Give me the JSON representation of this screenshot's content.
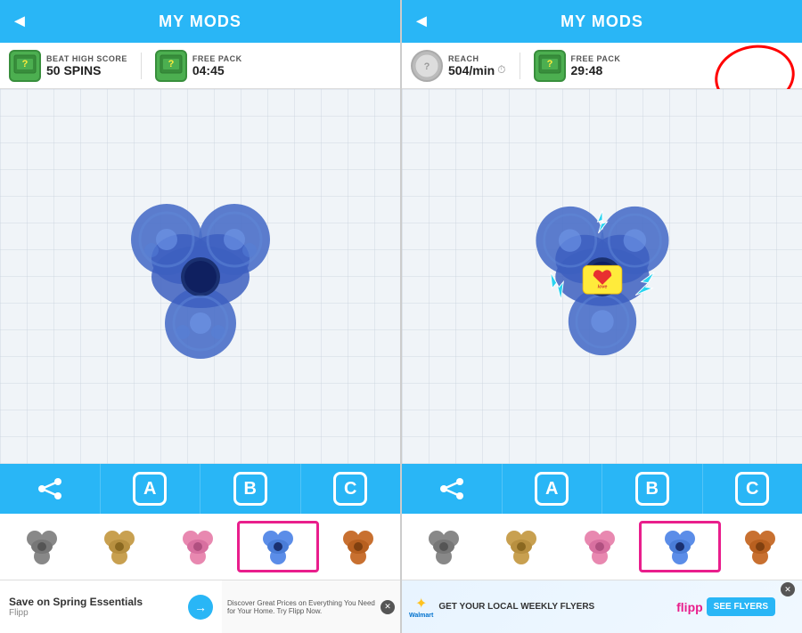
{
  "left_screen": {
    "header": {
      "title": "MY MODS",
      "back_label": "◄"
    },
    "stats": {
      "item1": {
        "label": "BEAT HIGH SCORE",
        "value": "50 SPINS"
      },
      "item2": {
        "label": "FREE PACK",
        "value": "04:45"
      }
    },
    "tabs": [
      {
        "id": "share",
        "label": "⁖",
        "type": "share"
      },
      {
        "id": "A",
        "label": "A"
      },
      {
        "id": "B",
        "label": "B"
      },
      {
        "id": "C",
        "label": "C"
      }
    ],
    "thumbnails": [
      {
        "id": "t1",
        "color": "#888",
        "selected": false
      },
      {
        "id": "t2",
        "color": "#c8a050",
        "selected": false
      },
      {
        "id": "t3",
        "color": "#e888b0",
        "selected": false
      },
      {
        "id": "t4",
        "color": "#5b8de8",
        "selected": true
      },
      {
        "id": "t5",
        "color": "#c87030",
        "selected": false
      }
    ],
    "ad": {
      "title": "Save on Spring Essentials",
      "source": "Flipp",
      "arrow": "→",
      "right_text": "Discover Great Prices on Everything You Need for Your Home. Try Flipp Now."
    }
  },
  "right_screen": {
    "header": {
      "title": "MY MODS",
      "back_label": "◄"
    },
    "stats": {
      "item1": {
        "label": "REACH",
        "value": "504/min"
      },
      "item2": {
        "label": "FREE PACK",
        "value": "29:48"
      }
    },
    "tabs": [
      {
        "id": "share",
        "label": "⁖",
        "type": "share"
      },
      {
        "id": "A",
        "label": "A"
      },
      {
        "id": "B",
        "label": "B"
      },
      {
        "id": "C",
        "label": "C"
      }
    ],
    "thumbnails": [
      {
        "id": "t1",
        "color": "#888",
        "selected": false
      },
      {
        "id": "t2",
        "color": "#c8a050",
        "selected": false
      },
      {
        "id": "t3",
        "color": "#e888b0",
        "selected": false
      },
      {
        "id": "t4",
        "color": "#5b8de8",
        "selected": true
      },
      {
        "id": "t5",
        "color": "#c87030",
        "selected": false
      }
    ],
    "ad": {
      "left_text": "GET YOUR LOCAL WEEKLY FLYERS",
      "see_flyers": "SEE FLYERS"
    },
    "annotation": "red circle around FREE PACK"
  }
}
